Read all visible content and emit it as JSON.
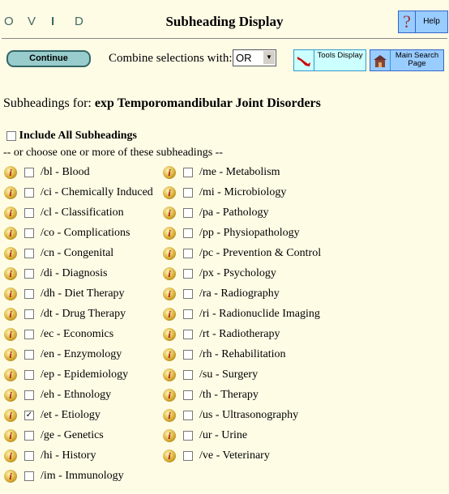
{
  "logo": [
    "O",
    "V",
    "I",
    "D"
  ],
  "title": "Subheading Display",
  "help": {
    "icon": "question-icon",
    "label": "Help"
  },
  "toolbar": {
    "continue": "Continue",
    "combine_label": "Combine selections with:",
    "combine_value": "OR",
    "tools": "Tools Display",
    "main": "Main Search Page"
  },
  "heading_prefix": "Subheadings for:",
  "heading_term": "exp Temporomandibular Joint Disorders",
  "include_all": "Include All Subheadings",
  "choose": "-- or choose one or more of these subheadings --",
  "col1": [
    {
      "label": "/bl - Blood",
      "checked": false
    },
    {
      "label": "/ci - Chemically Induced",
      "checked": false
    },
    {
      "label": "/cl - Classification",
      "checked": false
    },
    {
      "label": "/co - Complications",
      "checked": false
    },
    {
      "label": "/cn - Congenital",
      "checked": false
    },
    {
      "label": "/di - Diagnosis",
      "checked": false
    },
    {
      "label": "/dh - Diet Therapy",
      "checked": false
    },
    {
      "label": "/dt - Drug Therapy",
      "checked": false
    },
    {
      "label": "/ec - Economics",
      "checked": false
    },
    {
      "label": "/en - Enzymology",
      "checked": false
    },
    {
      "label": "/ep - Epidemiology",
      "checked": false
    },
    {
      "label": "/eh - Ethnology",
      "checked": false
    },
    {
      "label": "/et - Etiology",
      "checked": true
    },
    {
      "label": "/ge - Genetics",
      "checked": false
    },
    {
      "label": "/hi - History",
      "checked": false
    },
    {
      "label": "/im - Immunology",
      "checked": false
    }
  ],
  "col2": [
    {
      "label": "/me - Metabolism",
      "checked": false
    },
    {
      "label": "/mi - Microbiology",
      "checked": false
    },
    {
      "label": "/pa - Pathology",
      "checked": false
    },
    {
      "label": "/pp - Physiopathology",
      "checked": false
    },
    {
      "label": "/pc - Prevention & Control",
      "checked": false
    },
    {
      "label": "/px - Psychology",
      "checked": false
    },
    {
      "label": "/ra - Radiography",
      "checked": false
    },
    {
      "label": "/ri - Radionuclide Imaging",
      "checked": false
    },
    {
      "label": "/rt - Radiotherapy",
      "checked": false
    },
    {
      "label": "/rh - Rehabilitation",
      "checked": false
    },
    {
      "label": "/su - Surgery",
      "checked": false
    },
    {
      "label": "/th - Therapy",
      "checked": false
    },
    {
      "label": "/us - Ultrasonography",
      "checked": false
    },
    {
      "label": "/ur - Urine",
      "checked": false
    },
    {
      "label": "/ve - Veterinary",
      "checked": false
    }
  ]
}
